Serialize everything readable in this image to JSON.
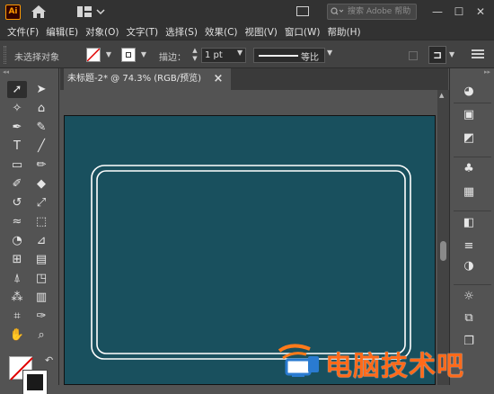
{
  "titlebar": {
    "app_icon": "Ai",
    "search_placeholder": "搜索 Adobe 帮助",
    "icons": [
      "home-icon",
      "workspace-icon",
      "window-arrange-icon",
      "search-icon"
    ],
    "window_buttons": [
      "—",
      "☐",
      "✕"
    ]
  },
  "menu": {
    "items": [
      "文件(F)",
      "编辑(E)",
      "对象(O)",
      "文字(T)",
      "选择(S)",
      "效果(C)",
      "视图(V)",
      "窗口(W)",
      "帮助(H)"
    ]
  },
  "control_bar": {
    "selection_status": "未选择对象",
    "stroke_label": "描边：",
    "stroke_weight": "1 pt",
    "profile_label": "等比",
    "colors": {
      "fill": "#ffffff",
      "stroke_none": "#e00000"
    }
  },
  "document": {
    "tab_title": "未标题-2* @ 74.3% (RGB/预览)",
    "close_label": "×"
  },
  "artboard": {
    "background": "#19505e",
    "frame_color": "#ffffff"
  },
  "toolbox": {
    "tools": [
      {
        "name": "selection-tool-icon",
        "glyph": "➚",
        "active": true
      },
      {
        "name": "direct-selection-tool-icon",
        "glyph": "➤"
      },
      {
        "name": "magic-wand-tool-icon",
        "glyph": "✧"
      },
      {
        "name": "lasso-tool-icon",
        "glyph": "⌂"
      },
      {
        "name": "pen-tool-icon",
        "glyph": "✒"
      },
      {
        "name": "curvature-tool-icon",
        "glyph": "✎"
      },
      {
        "name": "type-tool-icon",
        "glyph": "T"
      },
      {
        "name": "line-tool-icon",
        "glyph": "╱"
      },
      {
        "name": "rectangle-tool-icon",
        "glyph": "▭"
      },
      {
        "name": "paintbrush-tool-icon",
        "glyph": "✏"
      },
      {
        "name": "shaper-tool-icon",
        "glyph": "✐"
      },
      {
        "name": "eraser-tool-icon",
        "glyph": "◆"
      },
      {
        "name": "rotate-tool-icon",
        "glyph": "↺"
      },
      {
        "name": "scale-tool-icon",
        "glyph": "⤢"
      },
      {
        "name": "warp-tool-icon",
        "glyph": "≈"
      },
      {
        "name": "free-transform-tool-icon",
        "glyph": "⬚"
      },
      {
        "name": "shape-builder-tool-icon",
        "glyph": "◔"
      },
      {
        "name": "perspective-grid-tool-icon",
        "glyph": "⊿"
      },
      {
        "name": "mesh-tool-icon",
        "glyph": "⊞"
      },
      {
        "name": "gradient-tool-icon",
        "glyph": "▤"
      },
      {
        "name": "eyedropper-tool-icon",
        "glyph": "⍋"
      },
      {
        "name": "blend-tool-icon",
        "glyph": "◳"
      },
      {
        "name": "symbol-sprayer-tool-icon",
        "glyph": "⁂"
      },
      {
        "name": "column-graph-tool-icon",
        "glyph": "▥"
      },
      {
        "name": "artboard-tool-icon",
        "glyph": "⌗"
      },
      {
        "name": "slice-tool-icon",
        "glyph": "✑"
      },
      {
        "name": "hand-tool-icon",
        "glyph": "✋"
      },
      {
        "name": "zoom-tool-icon",
        "glyph": "⌕"
      }
    ],
    "swap_glyph": "↶"
  },
  "right_panel": {
    "icons": [
      {
        "name": "color-panel-icon",
        "glyph": "◕"
      },
      {
        "name": "color-guide-panel-icon",
        "glyph": "▣"
      },
      {
        "name": "libraries-panel-icon",
        "glyph": "◩"
      },
      {
        "name": "symbols-panel-icon",
        "glyph": "♣"
      },
      {
        "name": "brushes-panel-icon",
        "glyph": "▦"
      },
      {
        "name": "gradient-panel-icon",
        "glyph": "◧"
      },
      {
        "name": "stroke-panel-icon",
        "glyph": "≡"
      },
      {
        "name": "transparency-panel-icon",
        "glyph": "◑"
      },
      {
        "name": "appearance-panel-icon",
        "glyph": "☼"
      },
      {
        "name": "asset-export-panel-icon",
        "glyph": "⧉"
      },
      {
        "name": "layers-panel-icon",
        "glyph": "❐"
      }
    ]
  },
  "watermark": {
    "text": "电脑技术吧"
  }
}
